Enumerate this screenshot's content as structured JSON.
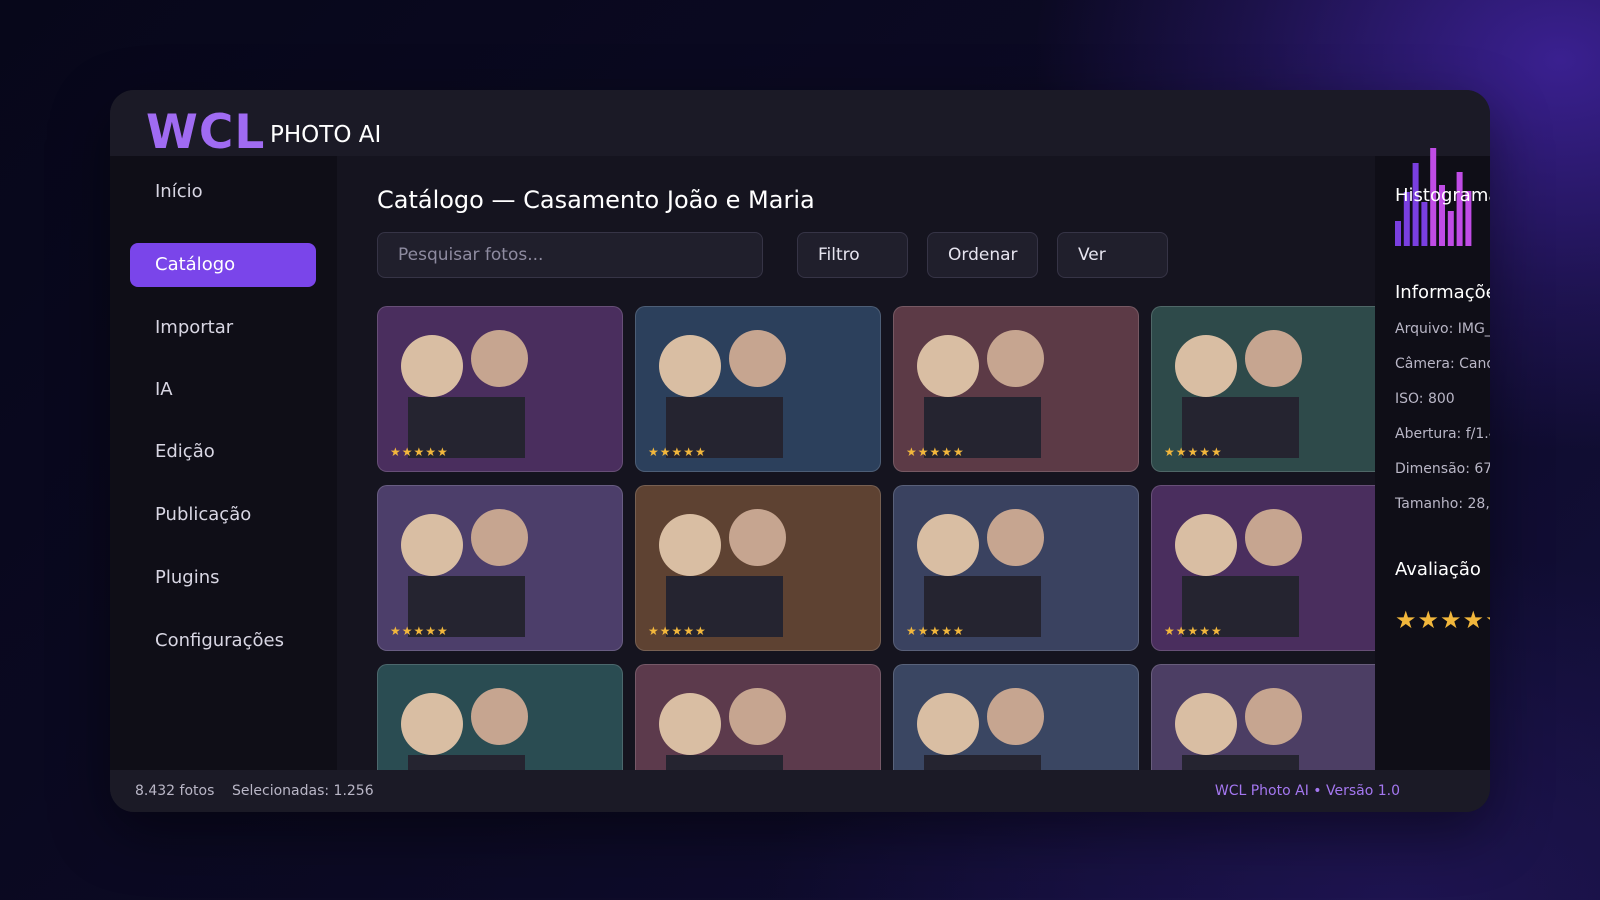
{
  "app": {
    "logo": "WCL",
    "logo_sub": "PHOTO AI"
  },
  "sidebar": {
    "items": [
      {
        "label": "Início",
        "active": false
      },
      {
        "label": "Catálogo",
        "active": true
      },
      {
        "label": "Importar",
        "active": false
      },
      {
        "label": "IA",
        "active": false
      },
      {
        "label": "Edição",
        "active": false
      },
      {
        "label": "Publicação",
        "active": false
      },
      {
        "label": "Plugins",
        "active": false
      },
      {
        "label": "Configurações",
        "active": false
      }
    ]
  },
  "main": {
    "title": "Catálogo — Casamento João e Maria",
    "search": {
      "placeholder": "Pesquisar fotos..."
    },
    "toolbar": {
      "filter_label": "Filtro",
      "sort_label": "Ordenar",
      "view_label": "Ver"
    },
    "photos": [
      {
        "color": "#4a2e5e",
        "stars": "★★★★★"
      },
      {
        "color": "#2c405c",
        "stars": "★★★★★"
      },
      {
        "color": "#5c3a46",
        "stars": "★★★★★"
      },
      {
        "color": "#2e4a4a",
        "stars": "★★★★★"
      },
      {
        "color": "#4c3e6a",
        "stars": "★★★★★"
      },
      {
        "color": "#5e4232",
        "stars": "★★★★★"
      },
      {
        "color": "#3a4260",
        "stars": "★★★★★"
      },
      {
        "color": "#4a2e5e",
        "stars": "★★★★★"
      },
      {
        "color": "#2a4c52",
        "stars": "★★★★★"
      },
      {
        "color": "#5c3a4c",
        "stars": "★★★★★"
      },
      {
        "color": "#3a4662",
        "stars": "★★★★★"
      },
      {
        "color": "#4c3e64",
        "stars": "★★★★★"
      }
    ]
  },
  "right_panel": {
    "histogram_title": "Histograma",
    "histogram_levels": [
      0.25,
      0.55,
      0.85,
      0.45,
      1.0,
      0.62,
      0.36,
      0.76,
      0.56
    ],
    "info_title": "Informações",
    "info": {
      "file": "Arquivo: IMG_1523.CR2",
      "camera": "Câmera: Canon EOS 5D",
      "iso": "ISO: 800",
      "aperture": "Abertura: f/1.4",
      "dimension": "Dimensão: 6720×4480",
      "size": "Tamanho: 28,4 MB"
    },
    "rating_title": "Avaliação",
    "rating_stars": "★★★★★"
  },
  "status": {
    "photo_count": "8.432 fotos",
    "selected": "Selecionadas: 1.256",
    "version": "WCL Photo AI • Versão 1.0"
  },
  "colors": {
    "accent": "#7a45ea",
    "logo": "#a06bf2",
    "star": "#f2b73c",
    "histogram_low": "#7a3fe0",
    "histogram_high": "#c04ce6"
  }
}
